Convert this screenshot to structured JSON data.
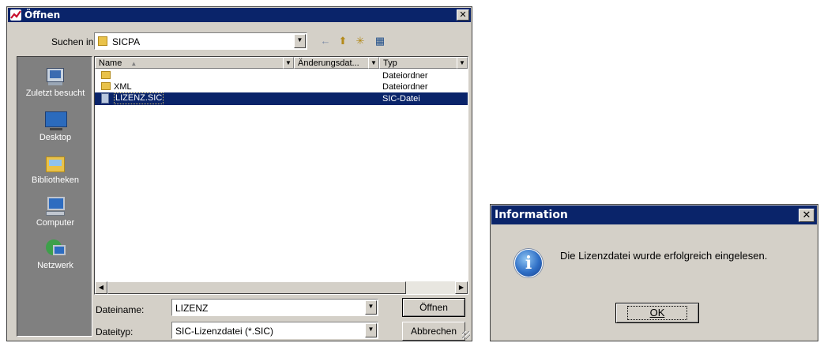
{
  "open_dialog": {
    "title": "Öffnen",
    "close_glyph": "✕",
    "look_in_label": "Suchen in:",
    "look_in_value": "SICPA",
    "toolbar": {
      "back_icon": "←",
      "up_icon": "⬆",
      "new_folder_icon": "✳",
      "view_icon": "▦"
    },
    "places": [
      {
        "label": "Zuletzt besucht",
        "icon": "recent-icon"
      },
      {
        "label": "Desktop",
        "icon": "desktop-icon"
      },
      {
        "label": "Bibliotheken",
        "icon": "libraries-icon"
      },
      {
        "label": "Computer",
        "icon": "computer-icon"
      },
      {
        "label": "Netzwerk",
        "icon": "network-icon"
      }
    ],
    "columns": {
      "name": "Name",
      "sort_glyph": "▲",
      "date": "Änderungsdat...",
      "type": "Typ"
    },
    "files": [
      {
        "name": "",
        "type": "Dateiordner"
      },
      {
        "name": "XML",
        "type": "Dateiordner"
      },
      {
        "name": "LIZENZ.SIC",
        "type": "SIC-Datei"
      }
    ],
    "filename_label": "Dateiname:",
    "filename_value": "LIZENZ",
    "filetype_label": "Dateityp:",
    "filetype_value": "SIC-Lizenzdatei (*.SIC)",
    "open_button": "Öffnen",
    "cancel_button": "Abbrechen",
    "scroll_left": "◀",
    "scroll_right": "▶",
    "dropdown_arrow": "▼"
  },
  "info_dialog": {
    "title": "Information",
    "close_glyph": "✕",
    "message": "Die Lizenzdatei wurde erfolgreich eingelesen.",
    "info_glyph": "i",
    "ok_button": "OK"
  },
  "colors": {
    "titlebar": "#0a246a",
    "face": "#d4d0c8",
    "selection": "#0a246a",
    "places_bg": "#808080"
  }
}
